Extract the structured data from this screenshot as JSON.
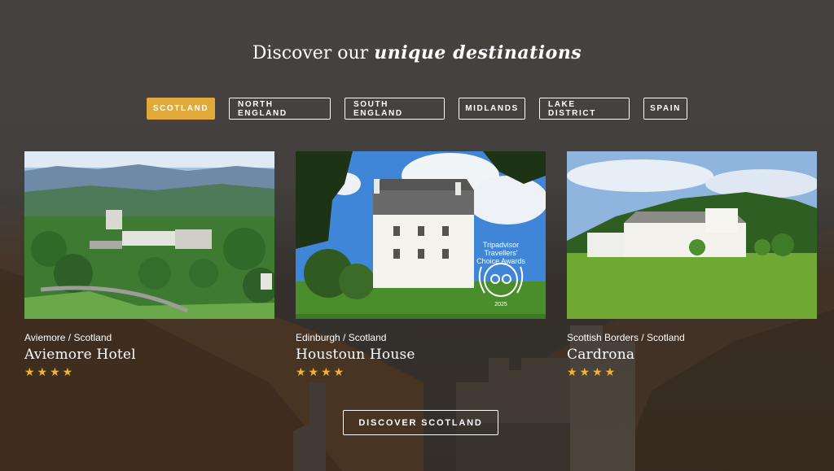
{
  "heading": {
    "prefix": "Discover our",
    "accent": "unique destinations"
  },
  "tabs": [
    {
      "label": "SCOTLAND",
      "active": true
    },
    {
      "label": "NORTH ENGLAND",
      "active": false
    },
    {
      "label": "SOUTH ENGLAND",
      "active": false
    },
    {
      "label": "MIDLANDS",
      "active": false
    },
    {
      "label": "LAKE DISTRICT",
      "active": false
    },
    {
      "label": "SPAIN",
      "active": false
    }
  ],
  "cards": [
    {
      "location": "Aviemore / Scotland",
      "name": "Aviemore Hotel",
      "stars": "★★★★",
      "star_count": 4
    },
    {
      "location": "Edinburgh / Scotland",
      "name": "Houstoun House",
      "stars": "★★★★",
      "star_count": 4,
      "badge": {
        "line1": "Tripadvisor",
        "line2": "Travellers'",
        "line3": "Choice Awards",
        "year": "2025"
      }
    },
    {
      "location": "Scottish Borders / Scotland",
      "name": "Cardrona",
      "stars": "★★★★",
      "star_count": 4
    }
  ],
  "cta": {
    "label": "DISCOVER SCOTLAND"
  },
  "colors": {
    "accent": "#e0a93a",
    "star": "#f2b233",
    "background": "#43403e"
  }
}
